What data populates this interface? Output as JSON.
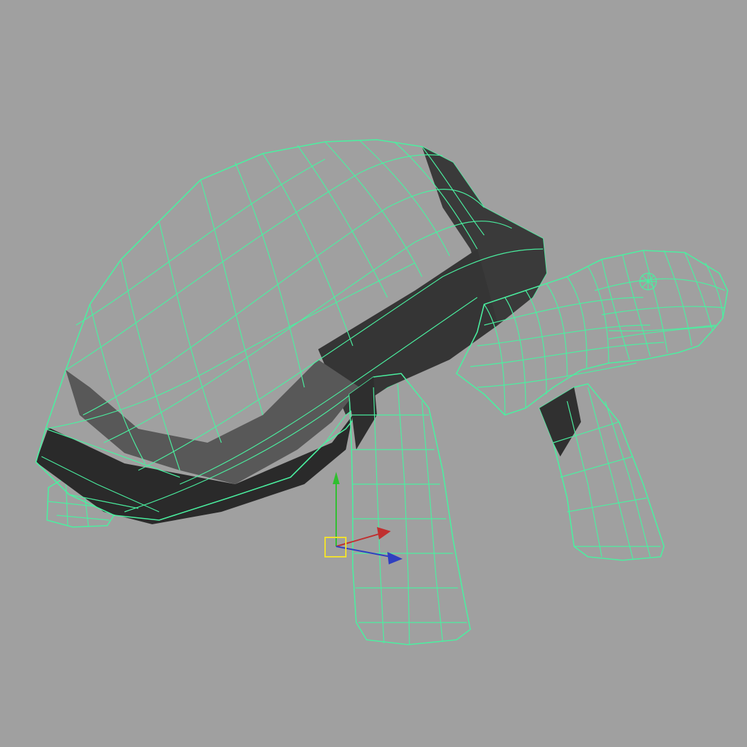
{
  "viewport": {
    "background_color": "#a0a0a0",
    "wireframe_color": "#4af0a0",
    "shell_face_color": "#5f5f5f",
    "shadow_face_color": "#2e2e2e",
    "body_face_color": "#626262",
    "selected_object": "tortoise-mesh",
    "display_mode": "shaded-with-wireframe"
  },
  "manipulator": {
    "type": "move-tool",
    "axes": [
      {
        "axis": "y",
        "color": "#2fbf2f"
      },
      {
        "axis": "x",
        "color": "#c03030"
      },
      {
        "axis": "z",
        "color": "#3040c0"
      }
    ],
    "center_handle_color": "#f0e030"
  }
}
